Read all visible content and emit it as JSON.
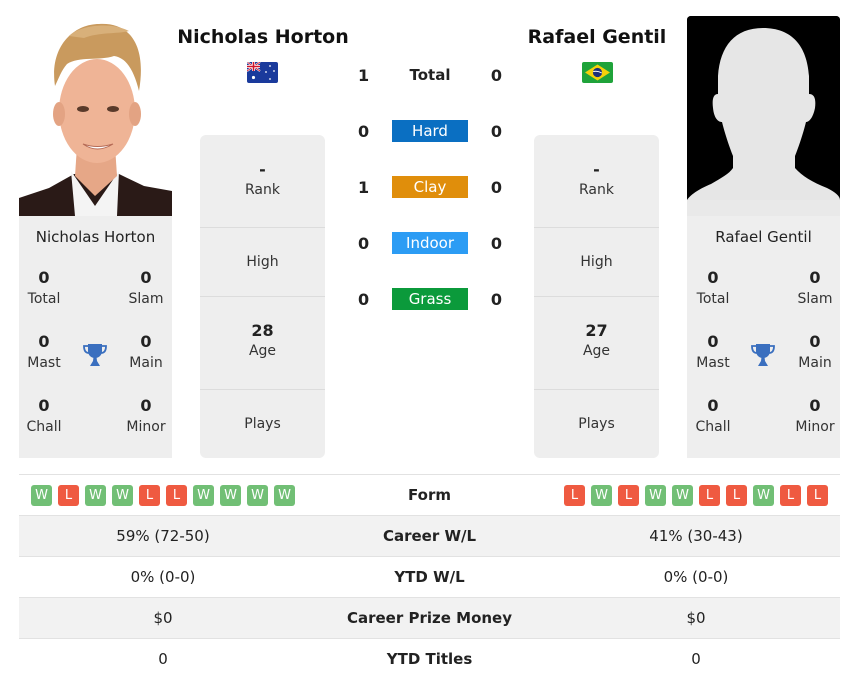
{
  "colors": {
    "hard": "#0a6fc2",
    "clay": "#e08e0b",
    "indoor": "#2c9cf4",
    "grass": "#0b9a3b",
    "win": "#71bf75",
    "loss": "#ef5a41",
    "trophy": "#3a6fbf"
  },
  "player1": {
    "name": "Nicholas Horton",
    "flag_icon": "australia-flag-icon",
    "photo": "player-photo",
    "rank": "-",
    "rank_label": "Rank",
    "high": "",
    "high_label": "High",
    "age": "28",
    "age_label": "Age",
    "plays": "",
    "plays_label": "Plays",
    "titles": {
      "total": "0",
      "total_label": "Total",
      "slam": "0",
      "slam_label": "Slam",
      "mast": "0",
      "mast_label": "Mast",
      "main": "0",
      "main_label": "Main",
      "chall": "0",
      "chall_label": "Chall",
      "minor": "0",
      "minor_label": "Minor"
    },
    "form": [
      "W",
      "L",
      "W",
      "W",
      "L",
      "L",
      "W",
      "W",
      "W",
      "W"
    ]
  },
  "player2": {
    "name": "Rafael Gentil",
    "flag_icon": "brazil-flag-icon",
    "photo": "placeholder-silhouette",
    "rank": "-",
    "rank_label": "Rank",
    "high": "",
    "high_label": "High",
    "age": "27",
    "age_label": "Age",
    "plays": "",
    "plays_label": "Plays",
    "titles": {
      "total": "0",
      "total_label": "Total",
      "slam": "0",
      "slam_label": "Slam",
      "mast": "0",
      "mast_label": "Mast",
      "main": "0",
      "main_label": "Main",
      "chall": "0",
      "chall_label": "Chall",
      "minor": "0",
      "minor_label": "Minor"
    },
    "form": [
      "L",
      "W",
      "L",
      "W",
      "W",
      "L",
      "L",
      "W",
      "L",
      "L"
    ]
  },
  "h2h": [
    {
      "label": "Total",
      "p1": "1",
      "p2": "0",
      "surface": "total"
    },
    {
      "label": "Hard",
      "p1": "0",
      "p2": "0",
      "surface": "hard"
    },
    {
      "label": "Clay",
      "p1": "1",
      "p2": "0",
      "surface": "clay"
    },
    {
      "label": "Indoor",
      "p1": "0",
      "p2": "0",
      "surface": "indoor"
    },
    {
      "label": "Grass",
      "p1": "0",
      "p2": "0",
      "surface": "grass"
    }
  ],
  "comparison": {
    "form_label": "Form",
    "rows": [
      {
        "label": "Career W/L",
        "p1": "59% (72-50)",
        "p2": "41% (30-43)"
      },
      {
        "label": "YTD W/L",
        "p1": "0% (0-0)",
        "p2": "0% (0-0)"
      },
      {
        "label": "Career Prize Money",
        "p1": "$0",
        "p2": "$0"
      },
      {
        "label": "YTD Titles",
        "p1": "0",
        "p2": "0"
      }
    ]
  }
}
